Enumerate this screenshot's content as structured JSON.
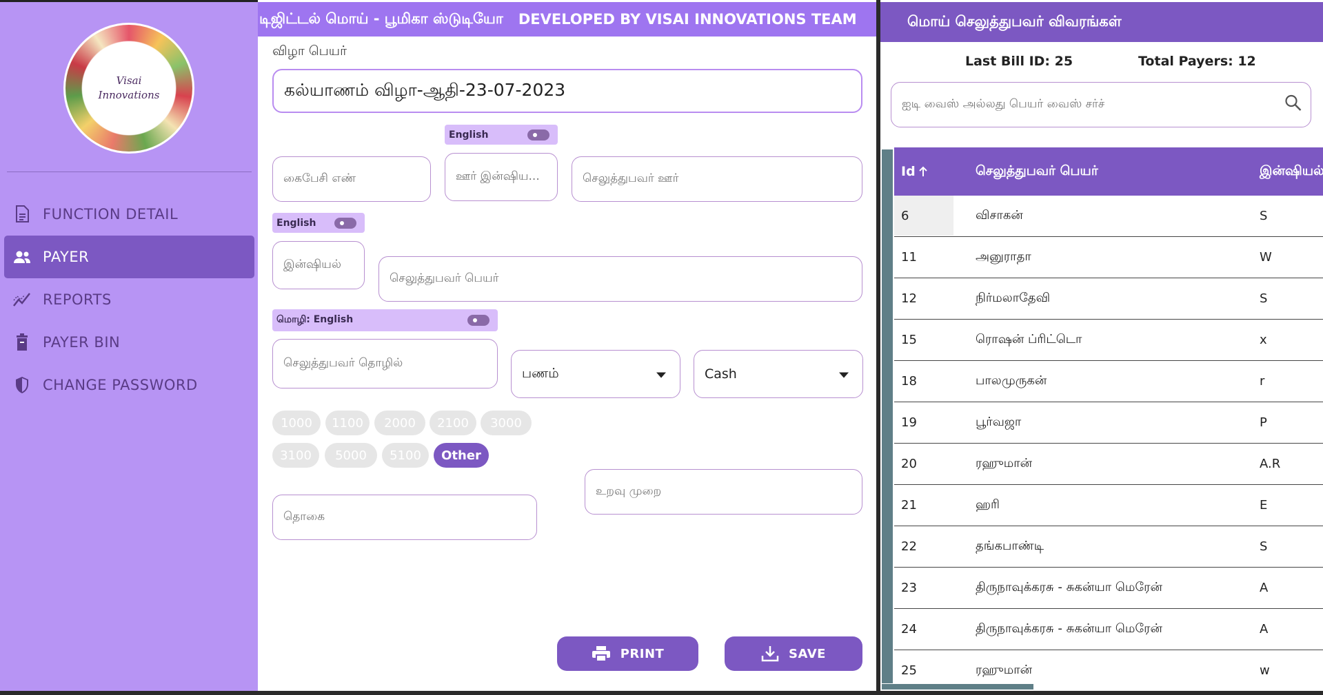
{
  "header": {
    "title": "டிஜிட்டல் மொய் - பூமிகா ஸ்டுடியோ",
    "developer": "DEVELOPED BY VISAI INNOVATIONS TEAM"
  },
  "logo": {
    "text_line1": "Visai",
    "text_line2": "Innovations"
  },
  "sidebar": {
    "items": [
      {
        "label": "FUNCTION DETAIL",
        "icon": "document-icon"
      },
      {
        "label": "PAYER",
        "icon": "people-icon"
      },
      {
        "label": "REPORTS",
        "icon": "chart-icon"
      },
      {
        "label": "PAYER BIN",
        "icon": "trash-icon"
      },
      {
        "label": "CHANGE PASSWORD",
        "icon": "shield-icon"
      }
    ],
    "active": "PAYER"
  },
  "form": {
    "festival_label": "விழா பெயர்",
    "festival_value": "கல்யாணம் விழா-ஆதி-23-07-2023",
    "toggle1": "English",
    "toggle2": "English",
    "toggle3": "மொழி: English",
    "mobile_placeholder": "கைபேசி எண்",
    "town_initial_placeholder": "ஊர் இன்ஷிய...",
    "payer_town_placeholder": "செலுத்துபவர் ஊர்",
    "initial_placeholder": "இன்ஷியல்",
    "payer_name_placeholder": "செலுத்துபவர் பெயர்",
    "payer_job_placeholder": "செலுத்துபவர் தொழில்",
    "type_value": "பணம்",
    "mode_value": "Cash",
    "amount_chips_row1": [
      "1000",
      "1100",
      "2000",
      "2100",
      "3000"
    ],
    "amount_chips_row2": [
      "3100",
      "5000",
      "5100"
    ],
    "other_chip": "Other",
    "amount_placeholder": "தொகை",
    "relation_placeholder": "உறவு முறை",
    "print_label": "PRINT",
    "save_label": "SAVE"
  },
  "right_panel": {
    "title": "மொய் செலுத்துபவர் விவரங்கள்",
    "last_bill": "Last Bill ID: 25",
    "total_payers": "Total Payers: 12",
    "search_placeholder": "ஐடி வைஸ் அல்லது பெயர் வைஸ் சர்ச்",
    "columns": {
      "id": "Id",
      "name": "செலுத்துபவர் பெயர்",
      "initial": "இன்ஷியல்"
    },
    "rows": [
      {
        "id": "6",
        "name": "விசாகன்",
        "initial": "S"
      },
      {
        "id": "11",
        "name": "அனுராதா",
        "initial": "W"
      },
      {
        "id": "12",
        "name": "நிர்மலாதேவி",
        "initial": "S"
      },
      {
        "id": "15",
        "name": "ரொஷன் ப்ரிட்டொ",
        "initial": "x"
      },
      {
        "id": "18",
        "name": "பாலமுருகன்",
        "initial": "r"
      },
      {
        "id": "19",
        "name": "பூர்வஜா",
        "initial": "P"
      },
      {
        "id": "20",
        "name": "ரஹுமான்",
        "initial": "A.R"
      },
      {
        "id": "21",
        "name": "ஹரி",
        "initial": "E"
      },
      {
        "id": "22",
        "name": "தங்கபாண்டி",
        "initial": "S"
      },
      {
        "id": "23",
        "name": "திருநாவுக்கரசு - சுகன்யா மெரேன்",
        "initial": "A"
      },
      {
        "id": "24",
        "name": "திருநாவுக்கரசு - சுகன்யா மெரேன்",
        "initial": "A"
      },
      {
        "id": "25",
        "name": "ரஹுமான்",
        "initial": "w"
      }
    ]
  },
  "colors": {
    "sidebar": "#b794f4",
    "accent": "#7c58c2",
    "header": "#9e75f0"
  }
}
